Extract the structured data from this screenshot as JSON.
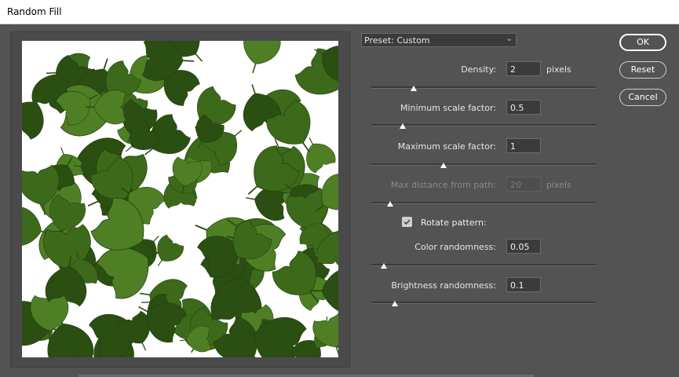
{
  "window": {
    "title": "Random Fill"
  },
  "preset": {
    "label": "Preset: Custom"
  },
  "controls": {
    "density": {
      "label": "Density:",
      "value": "2",
      "unit": "pixels",
      "slider_fraction": 0.19
    },
    "min_scale": {
      "label": "Minimum scale factor:",
      "value": "0.5",
      "slider_fraction": 0.14
    },
    "max_scale": {
      "label": "Maximum scale factor:",
      "value": "1",
      "slider_fraction": 0.32
    },
    "max_distance": {
      "label": "Max distance from path:",
      "value": "20",
      "unit": "pixels",
      "slider_fraction": 0.085,
      "disabled": true
    },
    "rotate": {
      "label": "Rotate pattern:",
      "checked": true
    },
    "color_randomness": {
      "label": "Color randomness:",
      "value": "0.05",
      "slider_fraction": 0.055
    },
    "brightness_randomness": {
      "label": "Brightness randomness:",
      "value": "0.1",
      "slider_fraction": 0.105
    }
  },
  "buttons": {
    "ok": "OK",
    "reset": "Reset",
    "cancel": "Cancel"
  },
  "colors": {
    "leaf_dark": "#2b4e12",
    "leaf_mid": "#3d6a1a",
    "leaf_light": "#4f7f25",
    "panel": "#535353"
  }
}
